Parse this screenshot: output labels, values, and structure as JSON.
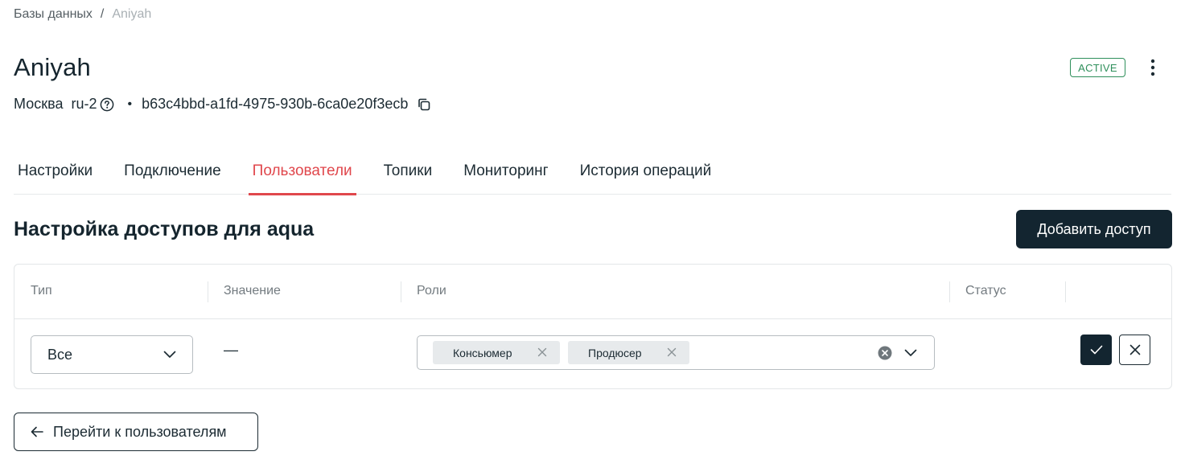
{
  "breadcrumb": {
    "root": "Базы данных",
    "separator": "/",
    "current": "Aniyah"
  },
  "header": {
    "title": "Aniyah",
    "status": "ACTIVE",
    "city": "Москва",
    "region": "ru-2",
    "bullet": "•",
    "id": "b63c4bbd-a1fd-4975-930b-6ca0e20f3ecb"
  },
  "tabs": [
    {
      "label": "Настройки",
      "active": false
    },
    {
      "label": "Подключение",
      "active": false
    },
    {
      "label": "Пользователи",
      "active": true
    },
    {
      "label": "Топики",
      "active": false
    },
    {
      "label": "Мониторинг",
      "active": false
    },
    {
      "label": "История операций",
      "active": false
    }
  ],
  "section": {
    "title": "Настройка доступов для aqua",
    "add_button": "Добавить доступ"
  },
  "table": {
    "columns": [
      "Тип",
      "Значение",
      "Роли",
      "Статус"
    ],
    "row": {
      "type_value": "Все",
      "value": "—",
      "roles": [
        "Консьюмер",
        "Продюсер"
      ],
      "status": ""
    }
  },
  "back_button": "Перейти к пользователям",
  "colors": {
    "accent": "#e0474c",
    "primary": "#132530",
    "success": "#2f8f5b"
  },
  "icons": [
    "help-icon",
    "copy-icon",
    "more-vertical-icon",
    "chevron-down-icon",
    "close-icon",
    "clear-icon",
    "check-icon",
    "arrow-left-icon"
  ]
}
